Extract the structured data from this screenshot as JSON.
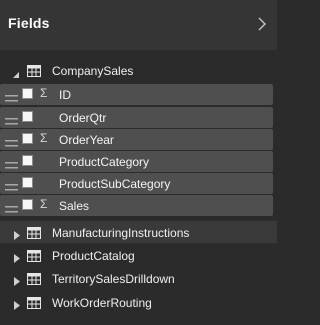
{
  "header": {
    "title": "Fields",
    "collapse_icon": "chevron-right-icon"
  },
  "tables": [
    {
      "name": "CompanySales",
      "expanded": true,
      "fields": [
        {
          "label": "ID",
          "aggregate": true,
          "checked": false
        },
        {
          "label": "OrderQtr",
          "aggregate": false,
          "checked": false
        },
        {
          "label": "OrderYear",
          "aggregate": true,
          "checked": false
        },
        {
          "label": "ProductCategory",
          "aggregate": false,
          "checked": false
        },
        {
          "label": "ProductSubCategory",
          "aggregate": false,
          "checked": false
        },
        {
          "label": "Sales",
          "aggregate": true,
          "checked": false
        }
      ]
    },
    {
      "name": "ManufacturingInstructions",
      "expanded": false
    },
    {
      "name": "ProductCatalog",
      "expanded": false
    },
    {
      "name": "TerritorySalesDrilldown",
      "expanded": false
    },
    {
      "name": "WorkOrderRouting",
      "expanded": false
    }
  ],
  "sigma_glyph": "Σ",
  "colors": {
    "pane_background": "#2b2b2b",
    "header_background": "#353535",
    "field_row_background": "#4f4f4f",
    "selected_table_background": "#3a3a3a",
    "text": "#f0f0f0"
  }
}
